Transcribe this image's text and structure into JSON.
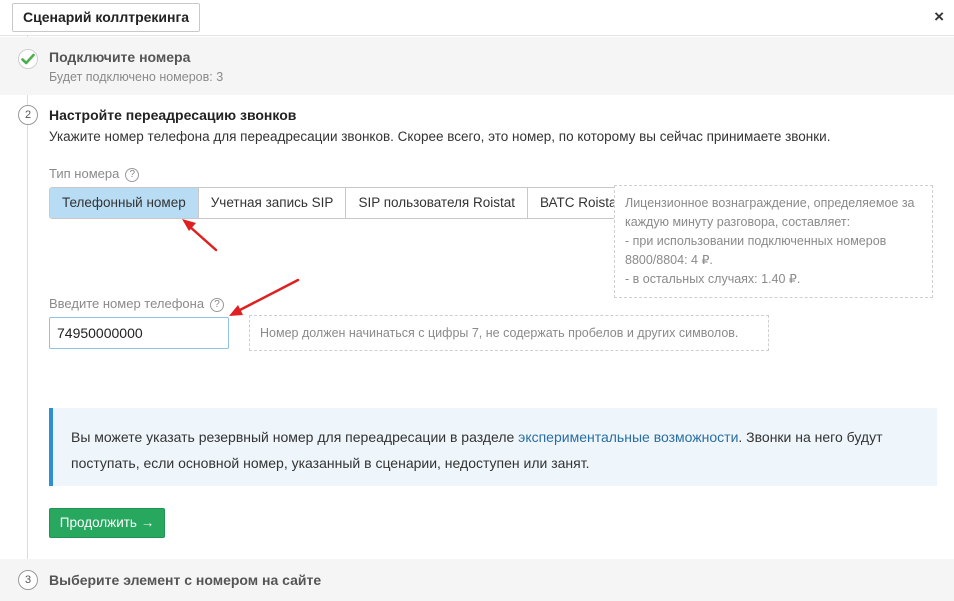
{
  "header": {
    "title": "Сценарий коллтрекинга",
    "close_symbol": "×"
  },
  "step1": {
    "title": "Подключите номера",
    "subtitle": "Будет подключено номеров: 3",
    "status_icon": "check-icon"
  },
  "step2": {
    "number": "2",
    "title": "Настройте переадресацию звонков",
    "description": "Укажите номер телефона для переадресации звонков. Скорее всего, это номер, по которому вы сейчас принимаете звонки.",
    "number_type_label": "Тип номера",
    "help_symbol": "?",
    "tabs": [
      {
        "label": "Телефонный номер",
        "active": true
      },
      {
        "label": "Учетная запись SIP",
        "active": false
      },
      {
        "label": "SIP пользователя Roistat",
        "active": false
      },
      {
        "label": "ВАТС Roistat",
        "active": false
      }
    ],
    "fee_hint": [
      "Лицензионное вознаграждение, определяемое за",
      "каждую минуту разговора, составляет:",
      "- при использовании подключенных номеров",
      "8800/8804: 4 ₽.",
      "- в остальных случаях: 1.40 ₽."
    ],
    "phone_label": "Введите номер телефона",
    "phone_value": "74950000000",
    "phone_hint": "Номер должен начинаться с цифры 7, не содержать пробелов и других символов.",
    "info": {
      "text_before": "Вы можете указать резервный номер для переадресации в разделе ",
      "link": "экспериментальные возможности",
      "text_after": ". Звонки на него будут поступать, если основной номер, указанный в сценарии, недоступен или занят."
    },
    "continue_label": "Продолжить →"
  },
  "step3": {
    "number": "3",
    "title": "Выберите элемент с номером на сайте"
  },
  "colors": {
    "accent_green": "#27a85e",
    "active_tab": "#b7dcf3",
    "info_border": "#2f8fd3",
    "arrow_red": "#e02020"
  }
}
